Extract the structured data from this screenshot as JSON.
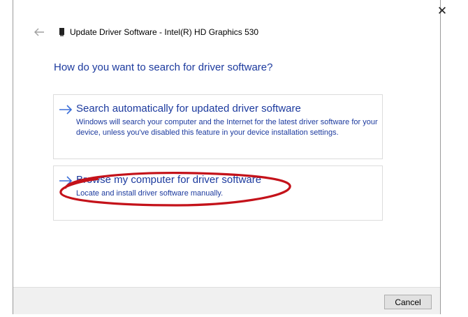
{
  "window": {
    "close_glyph": "✕"
  },
  "header": {
    "title": "Update Driver Software - Intel(R) HD Graphics 530",
    "back_icon": "back-arrow-icon",
    "device_icon": "display-adapter-icon"
  },
  "main": {
    "question": "How do you want to search for driver software?",
    "options": [
      {
        "title": "Search automatically for updated driver software",
        "description": "Windows will search your computer and the Internet for the latest driver software for your device, unless you've disabled this feature in your device installation settings.",
        "icon": "arrow-right-icon"
      },
      {
        "title": "Browse my computer for driver software",
        "description": "Locate and install driver software manually.",
        "icon": "arrow-right-icon"
      }
    ],
    "highlight_color": "#c4121a"
  },
  "footer": {
    "cancel_label": "Cancel"
  },
  "colors": {
    "link_blue": "#1c3a9e",
    "arrow_blue": "#3b6fd9",
    "footer_bg": "#f0f0f0"
  }
}
